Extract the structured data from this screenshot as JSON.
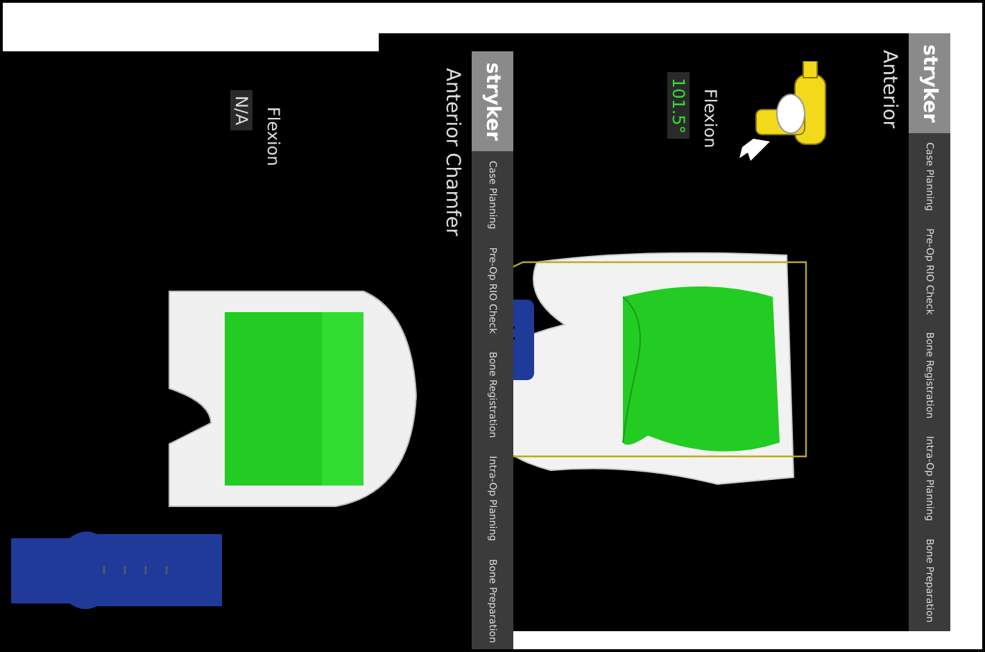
{
  "screens": [
    {
      "kind": "planning",
      "logo": "stryker",
      "nav_items": [
        "Case Planning",
        "Pre-Op RIO Check",
        "Bone Registration",
        "Intra-Op Planning",
        "Bone Preparation"
      ],
      "view_title": "Anterior",
      "flexion_label": "Flexion",
      "flexion_value": {
        "text": "101.5°",
        "active": true
      }
    },
    {
      "kind": "cutting",
      "logo": "stryker",
      "nav_items": [
        "Case Planning",
        "Pre-Op RIO Check",
        "Bone Registration",
        "Intra-Op Planning",
        "Bone Preparation"
      ],
      "view_title": "Anterior Chamfer",
      "flexion_label": "Flexion",
      "flexion_value": {
        "text": "N/A",
        "active": false
      }
    }
  ]
}
